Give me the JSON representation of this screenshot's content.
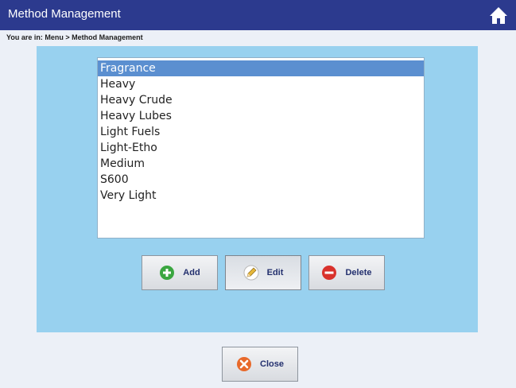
{
  "window": {
    "title": "Method Management"
  },
  "breadcrumb": "You are in: Menu > Method Management",
  "methods": {
    "items": [
      "Fragrance",
      "Heavy",
      "Heavy Crude",
      "Heavy Lubes",
      "Light Fuels",
      "Light-Etho",
      "Medium",
      "S600",
      "Very Light"
    ],
    "selected": "Fragrance"
  },
  "buttons": {
    "add": "Add",
    "edit": "Edit",
    "delete": "Delete",
    "close": "Close"
  },
  "colors": {
    "titlebar": "#2c3a8e",
    "panel": "#98d1ef",
    "selection": "#5b8fd0",
    "add_icon": "#3aa640",
    "delete_icon": "#d9322c",
    "close_icon": "#e8692a"
  },
  "icons": {
    "home": "home-icon",
    "add": "plus-circle-icon",
    "edit": "pencil-circle-icon",
    "delete": "minus-circle-icon",
    "close": "x-circle-icon"
  }
}
